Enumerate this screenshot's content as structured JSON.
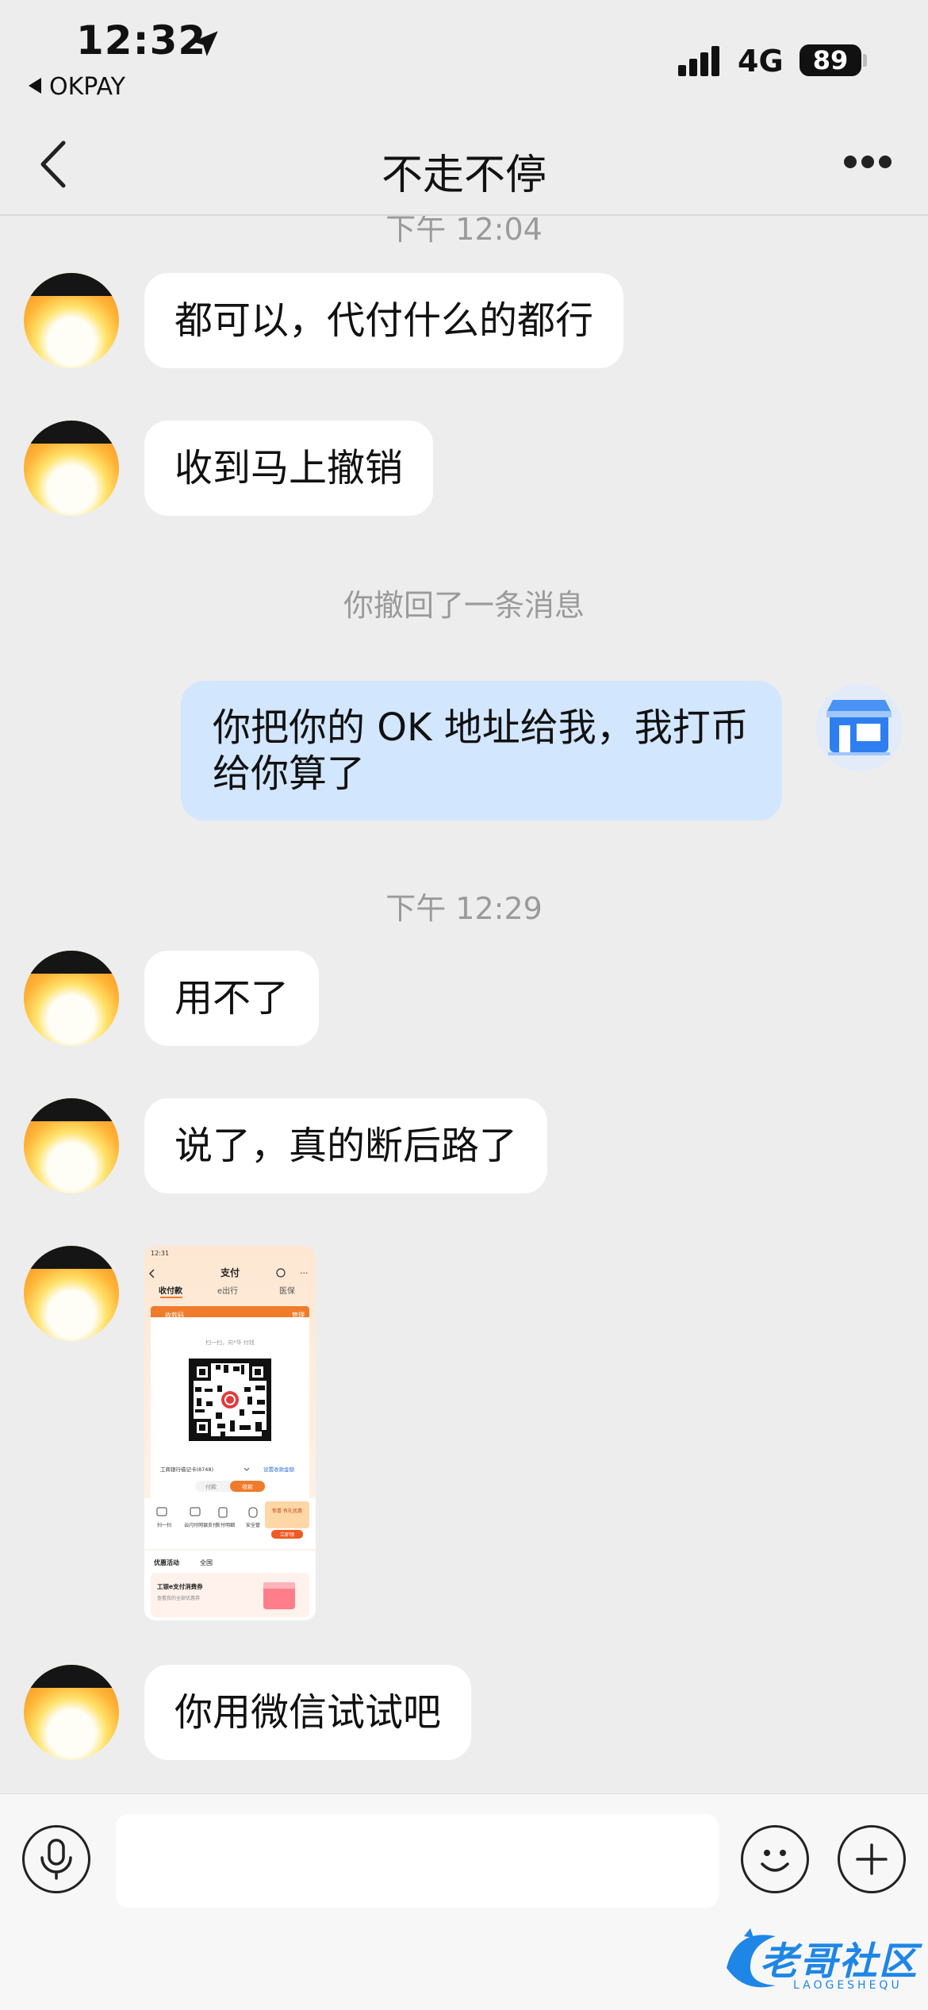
{
  "status_bar": {
    "time": "12:32",
    "back_app": "OKPAY",
    "network": "4G",
    "battery": "89"
  },
  "nav": {
    "title": "不走不停"
  },
  "messages": {
    "ts1": "下午 12:04",
    "m1": "都可以，代付什么的都行",
    "m2": "收到马上撤销",
    "recall": "你撤回了一条消息",
    "m3": "你把你的 OK 地址给我，我打币给你算了",
    "ts2": "下午 12:29",
    "m4": "用不了",
    "m5": "说了，真的断后路了",
    "m6": "你用微信试试吧"
  },
  "image_thumbnail": {
    "time": "12:31",
    "title": "支付",
    "tab1": "收付款",
    "tab2": "e出行",
    "tab3": "医保",
    "card_title": "收款码",
    "card_manage": "管理",
    "scan_hint": "扫一扫，向*华 付钱",
    "bank": "工商银行借记卡(8748)",
    "set_amount": "设置收款金额",
    "pay": "付款",
    "receive": "收款",
    "f1": "扫一扫",
    "f2": "云闪付网银支付",
    "f3": "支付明细",
    "f4": "安全管",
    "promo_badge": "优惠活动",
    "promo_all": "全国",
    "promo_title": "工银e支付消费券",
    "promo_sub": "查看我的全部优惠券",
    "gift": "惊喜\n有礼优惠",
    "gift_btn": "立即领"
  },
  "input": {
    "placeholder": ""
  },
  "watermark": {
    "text": "老哥社区",
    "sub": "LAOGESHEQU"
  },
  "colors": {
    "background": "#ededed",
    "bubble_self": "#d2e6fe",
    "bubble_other": "#ffffff",
    "timestamp": "#9a9a9a",
    "accent_orange": "#f07b2a",
    "watermark_blue": "#1e86e6"
  }
}
